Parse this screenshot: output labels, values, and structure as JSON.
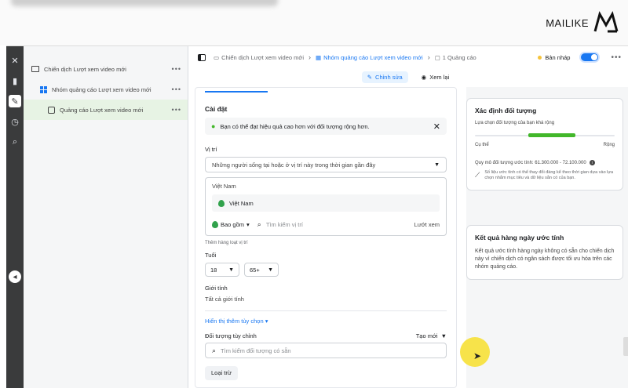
{
  "brand": {
    "text": "MAILIKE"
  },
  "breadcrumb": [
    {
      "label": "Chiến dịch Lượt xem video mới",
      "icon": "folder-icon"
    },
    {
      "label": "Nhóm quảng cáo Lượt xem video mới",
      "icon": "adset-grid-icon"
    },
    {
      "label": "1 Quảng cáo",
      "icon": "ad-icon"
    }
  ],
  "status": {
    "label": "Bản nháp",
    "dot_color": "#f5c33b",
    "published": true
  },
  "modes": {
    "edit": "Chỉnh sửa",
    "review": "Xem lại"
  },
  "tree": {
    "campaign": "Chiến dịch Lượt xem video mới",
    "adset": "Nhóm quảng cáo Lượt xem video mới",
    "ad": "Quảng cáo Lượt xem video mới"
  },
  "settings": {
    "title": "Cài đặt",
    "tip": "Bạn có thể đạt hiệu quả cao hơn với đối tượng rộng hơn.",
    "location": {
      "label": "Vị trí",
      "type": "Những người sống tại hoặc ở vị trí này trong thời gian gần đây",
      "group_label": "Việt Nam",
      "selected": "Việt Nam",
      "include": "Bao gồm",
      "search_placeholder": "Tìm kiếm vị trí",
      "browse": "Lướt xem",
      "bulk_hint": "Thêm hàng loạt vị trí"
    },
    "age": {
      "label": "Tuổi",
      "min": "18",
      "max": "65+"
    },
    "gender": {
      "label": "Giới tính",
      "value": "Tất cả giới tính"
    },
    "more_options": "Hiển thị thêm tùy chọn ▾",
    "custom_audience": {
      "label": "Đối tượng tùy chỉnh",
      "create": "Tạo mới",
      "search_placeholder": "Tìm kiếm đối tượng có sẵn",
      "exclude": "Loại trừ"
    }
  },
  "audience_card": {
    "title": "Xác định đối tượng",
    "subtitle": "Lựa chọn đối tượng của bạn khá rộng",
    "meter_level": 0.5,
    "meter_start": 0.38,
    "meter_end": 0.72,
    "left_label": "Cụ thể",
    "right_label": "Rộng",
    "size": "Quy mô đối tượng ước tính: 61.300.000 - 72.100.000",
    "note": "Số liệu ước tính có thể thay đổi đáng kể theo thời gian dựa vào lựa chọn nhắm mục tiêu và dữ liệu sẵn có của bạn."
  },
  "results_card": {
    "title": "Kết quả hàng ngày ước tính",
    "body": "Kết quả ước tính hàng ngày không có sẵn cho chiến dịch này vì chiến dịch có ngân sách được tối ưu hóa trên các nhóm quảng cáo."
  },
  "colors": {
    "accent": "#1877f2",
    "success": "#42b72a",
    "rail": "#3a3b3c",
    "highlight": "#f7e34a"
  }
}
